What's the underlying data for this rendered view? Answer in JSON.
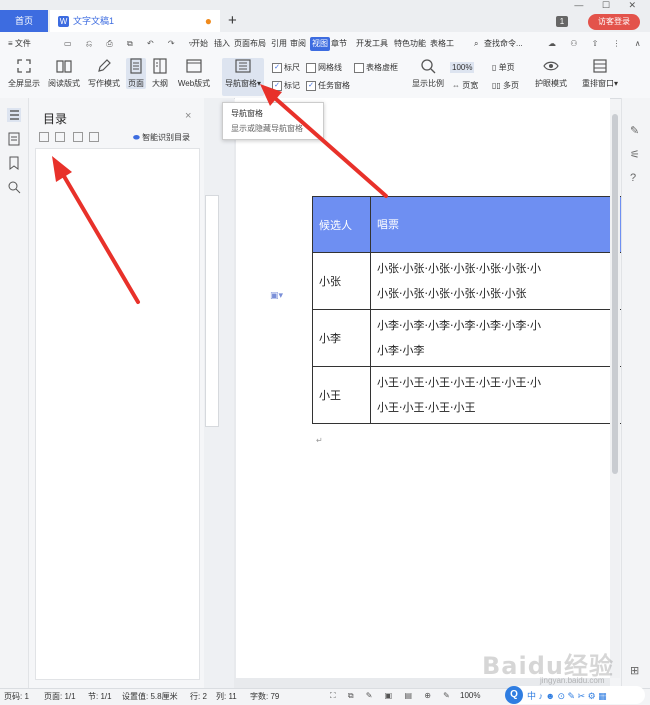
{
  "tabs": {
    "home": "首页",
    "doc": "文字文稿1",
    "add": "+"
  },
  "window": {
    "controls": "— ☐ ✕",
    "page_count": "1",
    "visitor_login": "访客登录"
  },
  "menu": {
    "file": "≡ 文件",
    "items": [
      "开始",
      "插入",
      "页面布局",
      "引用",
      "审阅",
      "视图",
      "章节",
      "开发工具",
      "特色功能",
      "表格工"
    ],
    "search": "查找命令..."
  },
  "ribbon": {
    "buttons": [
      "全屏显示",
      "阅读版式",
      "写作模式",
      "页面",
      "大纲",
      "Web版式",
      "导航窗格"
    ],
    "checks": [
      {
        "label": "标尺",
        "checked": true
      },
      {
        "label": "网格线",
        "checked": false
      },
      {
        "label": "表格虚框",
        "checked": false
      },
      {
        "label": "标记",
        "checked": true
      },
      {
        "label": "任务窗格",
        "checked": true
      }
    ],
    "zoom_label": "显示比例",
    "zoom_value": "100%",
    "page_width": "页宽",
    "single_page": "单页",
    "multi_page": "多页",
    "eye_mode": "护眼模式",
    "rearrange": "重排窗口"
  },
  "tooltip": {
    "title": "导航窗格",
    "desc": "显示或隐藏导航窗格"
  },
  "toc": {
    "title": "目录",
    "close": "×",
    "smart": "智能识别目录"
  },
  "table": {
    "header": [
      "候选人",
      "唱票"
    ],
    "rows": [
      {
        "name": "小张",
        "line1": "小张·小张·小张·小张·小张·小张·小",
        "line2": "小张·小张·小张·小张·小张·小张"
      },
      {
        "name": "小李",
        "line1": "小李·小李·小李·小李·小李·小李·小",
        "line2": "小李·小李"
      },
      {
        "name": "小王",
        "line1": "小王·小王·小王·小王·小王·小王·小",
        "line2": "小王·小王·小王·小王"
      }
    ]
  },
  "status": {
    "page": "页码: 1",
    "pages": "页面: 1/1",
    "section": "节: 1/1",
    "setting": "设置值: 5.8厘米",
    "row": "行: 2",
    "col": "列: 11",
    "words": "字数: 79",
    "zoom": "100%"
  },
  "ime": {
    "logo": "Q",
    "text": "中 ♪ ☻ ⊙ ✎ ✂ ⚙ ▦"
  },
  "watermark": {
    "main": "Baidu经验",
    "sub": "jingyan.baidu.com"
  },
  "colors": {
    "accent": "#3d6ce0",
    "table_header": "#6e8ff2",
    "arrow": "#e8312a",
    "visitor": "#e3534b"
  }
}
